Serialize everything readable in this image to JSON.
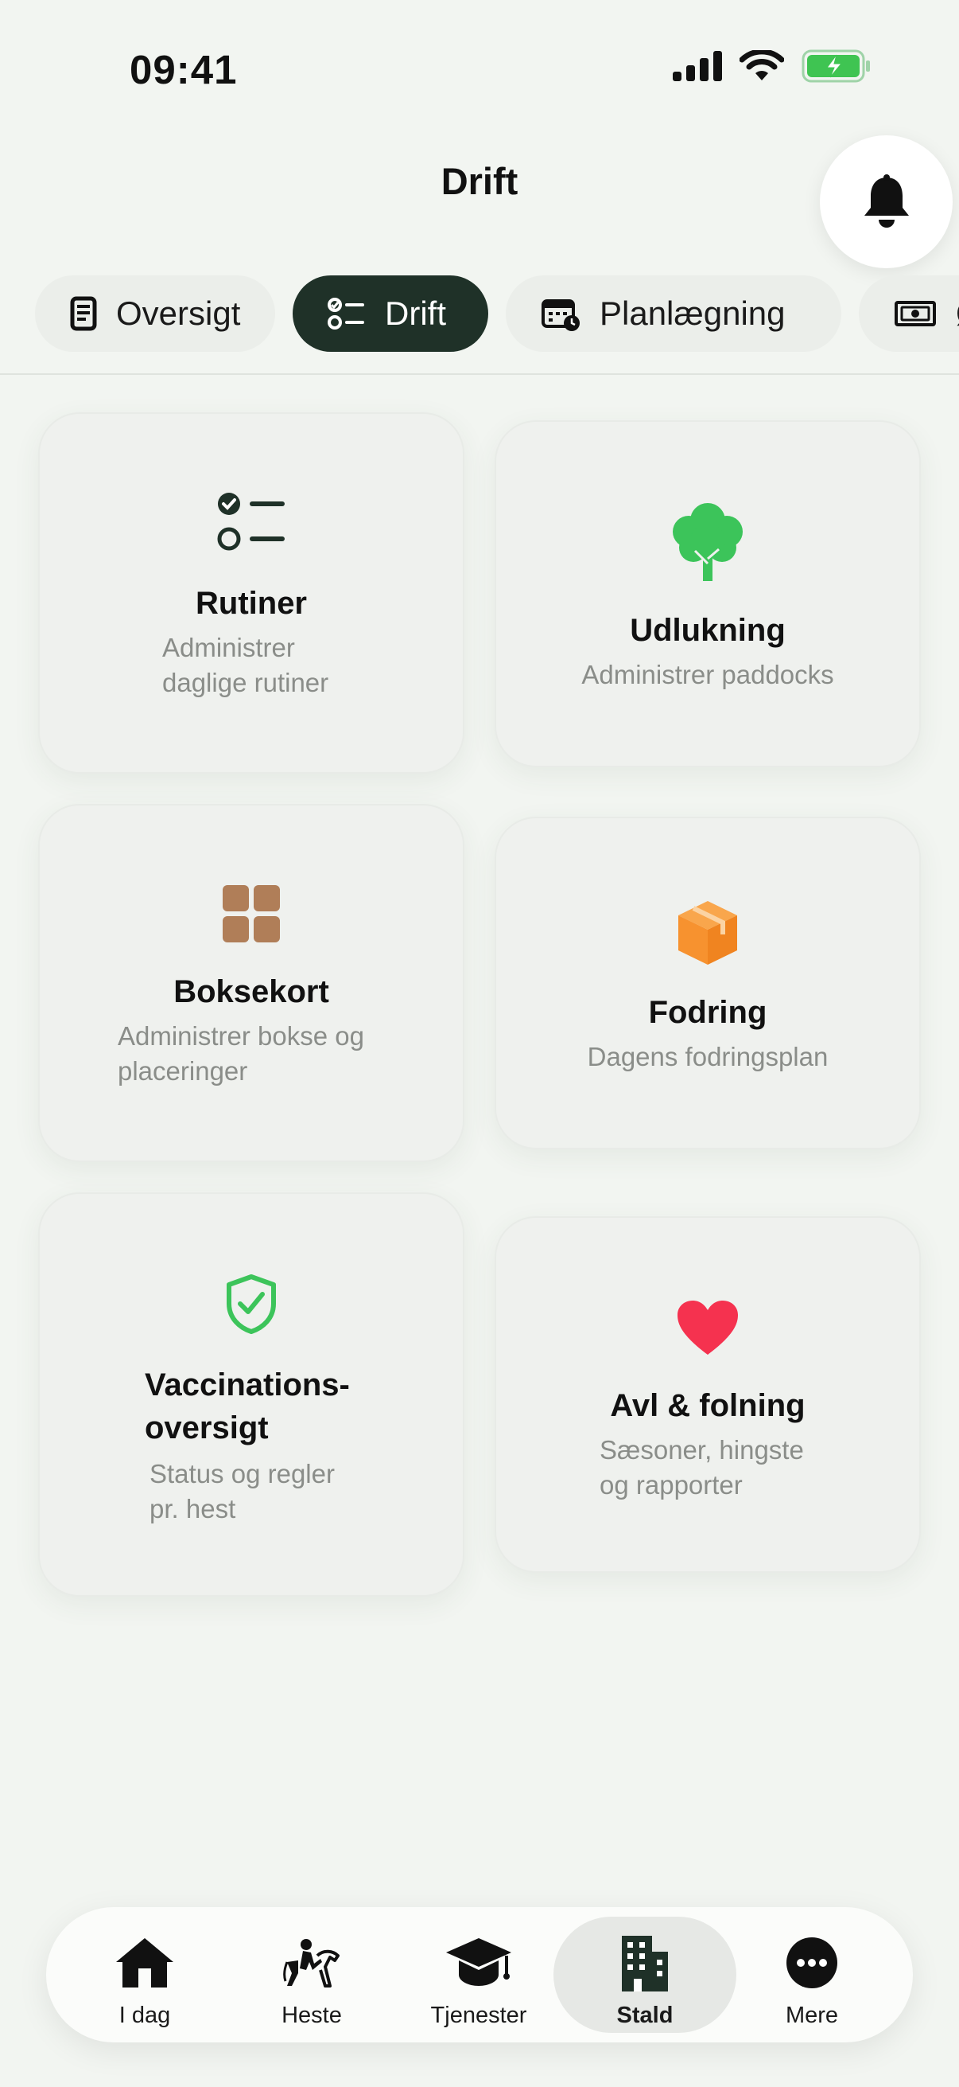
{
  "status_bar": {
    "time": "09:41"
  },
  "header": {
    "title": "Drift"
  },
  "tabs": [
    {
      "label": "Oversigt",
      "icon": "document-icon"
    },
    {
      "label": "Drift",
      "icon": "checklist-icon",
      "active": true
    },
    {
      "label": "Planlægning",
      "icon": "calendar-clock-icon"
    },
    {
      "label": "Øk",
      "icon": "banknote-icon"
    }
  ],
  "cards": [
    {
      "title": "Rutiner",
      "subtitle_1": "Administrer",
      "subtitle_2": "daglige rutiner",
      "icon": "checklist-icon"
    },
    {
      "title": "Udlukning",
      "subtitle_1": "Administrer paddocks",
      "icon": "tree-icon",
      "icon_color": "#3cc45a"
    },
    {
      "title": "Boksekort",
      "subtitle_1": "Administrer bokse og",
      "subtitle_2": "placeringer",
      "icon": "grid-icon",
      "icon_color": "#b07e58"
    },
    {
      "title": "Fodring",
      "subtitle_1": "Dagens fodringsplan",
      "icon": "box-icon",
      "icon_color": "#f7922f"
    },
    {
      "title_1": "Vaccinations-",
      "title_2": "oversigt",
      "subtitle_1": "Status og regler",
      "subtitle_2": "pr. hest",
      "icon": "shield-check-icon",
      "icon_color": "#3cc45a"
    },
    {
      "title": "Avl & folning",
      "subtitle_1": "Sæsoner, hingste",
      "subtitle_2": "og rapporter",
      "icon": "heart-icon",
      "icon_color": "#f5324f"
    }
  ],
  "bottom_nav": [
    {
      "label": "I dag",
      "icon": "house-icon"
    },
    {
      "label": "Heste",
      "icon": "horse-rider-icon"
    },
    {
      "label": "Tjenester",
      "icon": "graduation-cap-icon"
    },
    {
      "label": "Stald",
      "icon": "building-icon",
      "active": true
    },
    {
      "label": "Mere",
      "icon": "more-icon"
    }
  ]
}
